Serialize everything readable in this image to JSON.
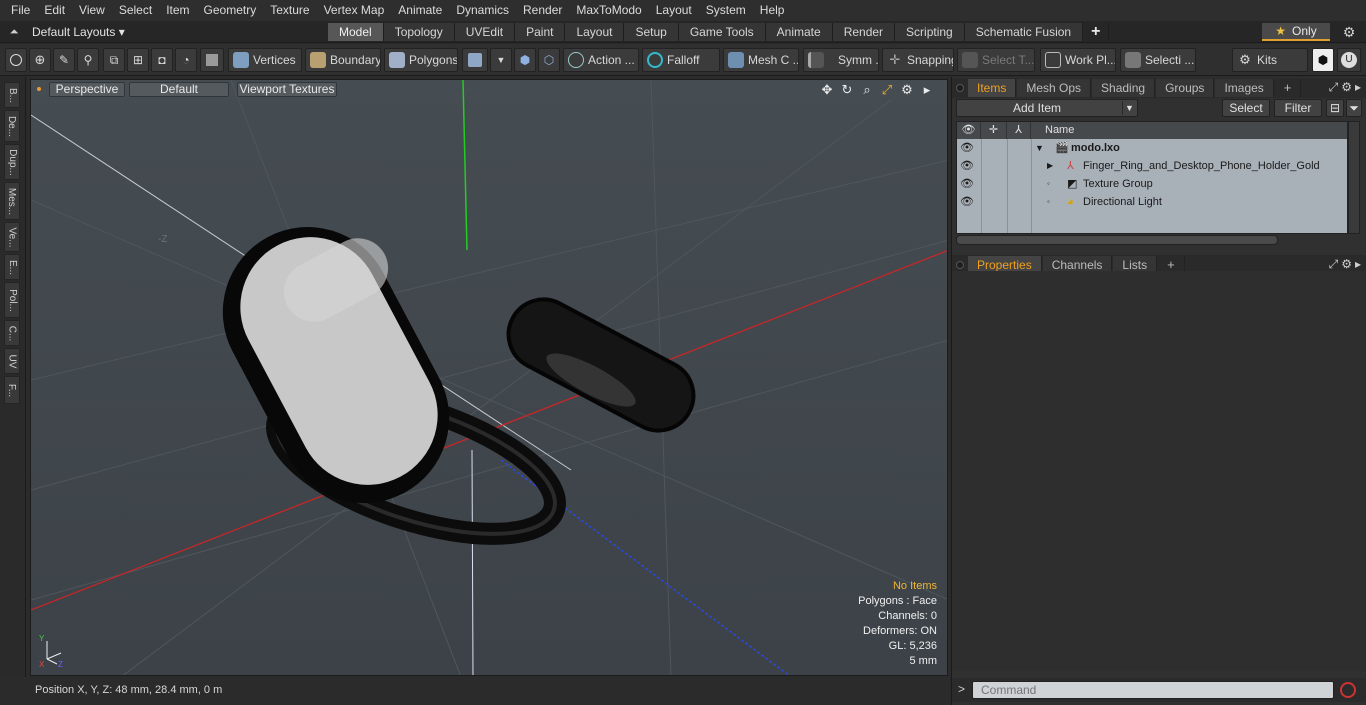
{
  "menubar": {
    "items": [
      "File",
      "Edit",
      "View",
      "Select",
      "Item",
      "Geometry",
      "Texture",
      "Vertex Map",
      "Animate",
      "Dynamics",
      "Render",
      "MaxToModo",
      "Layout",
      "System",
      "Help"
    ]
  },
  "layouts": {
    "selector": "Default Layouts ▾",
    "tabs": [
      "Model",
      "Topology",
      "UVEdit",
      "Paint",
      "Layout",
      "Setup",
      "Game Tools",
      "Animate",
      "Render",
      "Scripting",
      "Schematic Fusion"
    ],
    "active_tab": "Model",
    "add": "+",
    "only_label": "Only"
  },
  "toolbar": {
    "vertices": "Vertices",
    "boundary": "Boundary",
    "polygons": "Polygons",
    "action": "Action ...",
    "falloff": "Falloff",
    "mesh_c": "Mesh C ...",
    "symm": "Symm ...",
    "snapping": "Snapping",
    "select_t": "Select T...",
    "work_pl": "Work Pl...",
    "selecti": "Selecti ...",
    "kits": "Kits"
  },
  "leftstrip": {
    "tabs": [
      "B...",
      "De...",
      "Dup...",
      "Mes...",
      "Ve...",
      "E...",
      "Pol...",
      "C...",
      "UV",
      "F..."
    ]
  },
  "viewport": {
    "perspective": "Perspective",
    "default": "Default",
    "textures": "Viewport Textures",
    "info": {
      "no_items": "No Items",
      "polygons": "Polygons : Face",
      "channels": "Channels: 0",
      "deformers": "Deformers: ON",
      "gl": "GL: 5,236",
      "scale": "5 mm"
    },
    "axis_minus_z": "-Z",
    "gizmo": {
      "x": "X",
      "y": "Y",
      "z": "Z"
    }
  },
  "status": {
    "position": "Position X, Y, Z:  48 mm, 28.4 mm, 0 m"
  },
  "items_panel": {
    "tabs": [
      "Items",
      "Mesh Ops",
      "Shading",
      "Groups",
      "Images"
    ],
    "active_tab": "Items",
    "add": "+",
    "add_item": "Add Item",
    "select": "Select",
    "filter": "Filter",
    "column_name": "Name",
    "tree": [
      {
        "label": "modo.lxo",
        "indent": 0,
        "bold": true,
        "expander": "▼",
        "icon": "scene-icon"
      },
      {
        "label": "Finger_Ring_and_Desktop_Phone_Holder_Gold",
        "indent": 1,
        "bold": false,
        "expander": "▶",
        "icon": "mesh-icon"
      },
      {
        "label": "Texture Group",
        "indent": 1,
        "bold": false,
        "expander": "◦",
        "icon": "texture-group-icon"
      },
      {
        "label": "Directional Light",
        "indent": 1,
        "bold": false,
        "expander": "◦",
        "icon": "light-icon"
      }
    ]
  },
  "properties_panel": {
    "tabs": [
      "Properties",
      "Channels",
      "Lists"
    ],
    "active_tab": "Properties",
    "add": "+"
  },
  "command": {
    "prompt": ">",
    "placeholder": "Command"
  },
  "colors": {
    "accent": "#f0a020",
    "viewport_bg": "#41474d",
    "x_axis": "#d02020",
    "y_axis": "#20c020",
    "z_axis": "#2040e0"
  }
}
